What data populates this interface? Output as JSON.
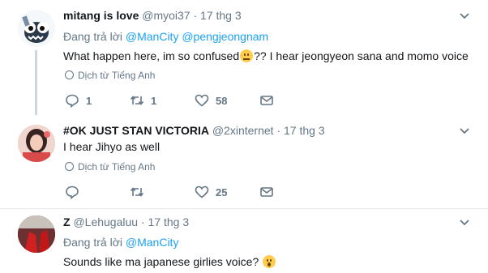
{
  "tweets": [
    {
      "name": "mitang is love",
      "handle": "@myoi37",
      "time": "17 thg 3",
      "reply_prefix": "Đang trả lời",
      "reply_mentions": [
        "@ManCity",
        "@pengjeongnam"
      ],
      "text_before": "What happen here, im so confused",
      "text_after": "?? I hear jeongyeon sana and momo voice",
      "translate": "Dịch từ Tiếng Anh",
      "replies": "1",
      "retweets": "1",
      "likes": "58"
    },
    {
      "name": "#OK JUST STAN VICTORIA",
      "handle": "@2xinternet",
      "time": "17 thg 3",
      "text": "I hear Jihyo as well",
      "translate": "Dịch từ Tiếng Anh",
      "replies": "",
      "retweets": "",
      "likes": "25"
    },
    {
      "name": "Z",
      "handle": "@Lehugaluu",
      "time": "17 thg 3",
      "reply_prefix": "Đang trả lời",
      "reply_mentions": [
        "@ManCity"
      ],
      "text": "Sounds like ma japanese girlies voice?"
    }
  ],
  "separator": "·",
  "colors": {
    "link": "#1da1f2",
    "muted": "#657786",
    "border": "#e6ecf0"
  }
}
